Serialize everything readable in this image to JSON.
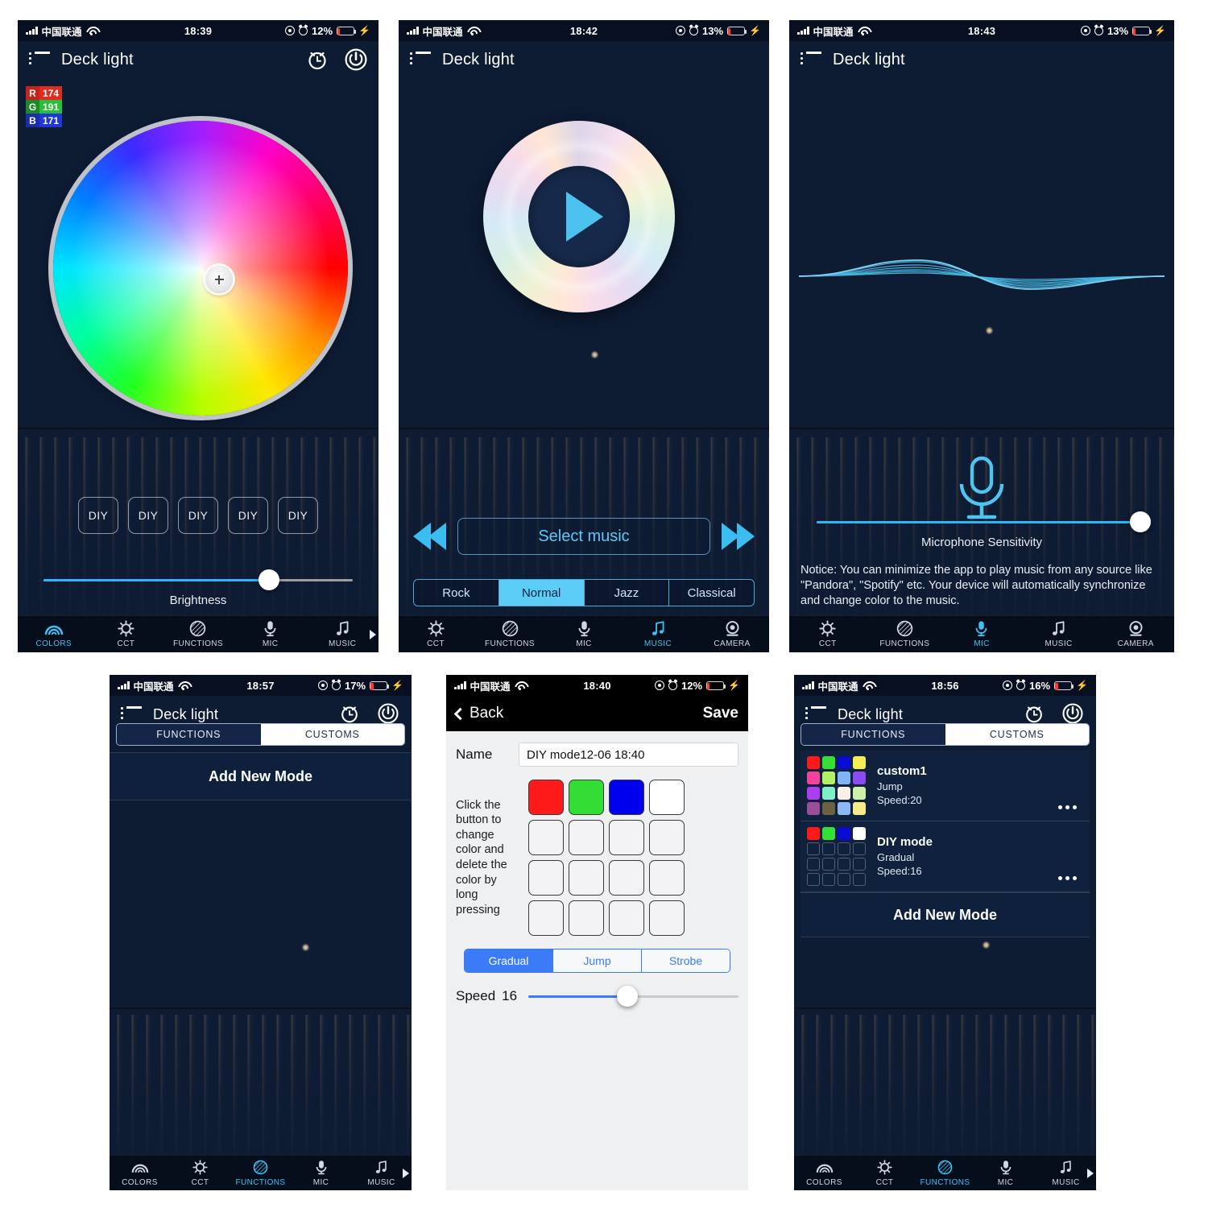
{
  "app": {
    "title": "Deck light"
  },
  "panels": {
    "colors": {
      "status": {
        "carrier": "中国联通",
        "time": "18:39",
        "battery_pct": "12%"
      },
      "rgb": {
        "r_key": "R",
        "r_val": "174",
        "g_key": "G",
        "g_val": "191",
        "b_key": "B",
        "b_val": "171"
      },
      "diy_buttons": [
        "DIY",
        "DIY",
        "DIY",
        "DIY",
        "DIY"
      ],
      "brightness_label": "Brightness",
      "brightness_pct": 73,
      "tabs": [
        {
          "label": "COLORS",
          "icon": "rainbow-icon",
          "active": true
        },
        {
          "label": "CCT",
          "icon": "sun-icon",
          "active": false
        },
        {
          "label": "FUNCTIONS",
          "icon": "hatched-circle-icon",
          "active": false
        },
        {
          "label": "MIC",
          "icon": "microphone-icon",
          "active": false
        },
        {
          "label": "MUSIC",
          "icon": "music-note-icon",
          "active": false
        }
      ]
    },
    "music": {
      "status": {
        "carrier": "中国联通",
        "time": "18:42",
        "battery_pct": "13%"
      },
      "select_music_label": "Select music",
      "prev_label": "previous",
      "next_label": "next",
      "genres": [
        {
          "label": "Rock",
          "active": false
        },
        {
          "label": "Normal",
          "active": true
        },
        {
          "label": "Jazz",
          "active": false
        },
        {
          "label": "Classical",
          "active": false
        }
      ],
      "tabs": [
        {
          "label": "CCT",
          "icon": "sun-icon",
          "active": false
        },
        {
          "label": "FUNCTIONS",
          "icon": "hatched-circle-icon",
          "active": false
        },
        {
          "label": "MIC",
          "icon": "microphone-icon",
          "active": false
        },
        {
          "label": "MUSIC",
          "icon": "music-note-icon",
          "active": true
        },
        {
          "label": "CAMERA",
          "icon": "camera-icon",
          "active": false
        }
      ]
    },
    "mic": {
      "status": {
        "carrier": "中国联通",
        "time": "18:43",
        "battery_pct": "13%"
      },
      "sensitivity_label": "Microphone Sensitivity",
      "sensitivity_pct": 97,
      "notice": "Notice: You can minimize the app to play music from any source like \"Pandora\", \"Spotify\" etc. Your device will automatically synchronize and change color to the music.",
      "tabs": [
        {
          "label": "CCT",
          "icon": "sun-icon",
          "active": false
        },
        {
          "label": "FUNCTIONS",
          "icon": "hatched-circle-icon",
          "active": false
        },
        {
          "label": "MIC",
          "icon": "microphone-icon",
          "active": true
        },
        {
          "label": "MUSIC",
          "icon": "music-note-icon",
          "active": false
        },
        {
          "label": "CAMERA",
          "icon": "camera-icon",
          "active": false
        }
      ]
    },
    "customs_empty": {
      "status": {
        "carrier": "中国联通",
        "time": "18:57",
        "battery_pct": "17%"
      },
      "seg": {
        "functions": "FUNCTIONS",
        "customs": "CUSTOMS",
        "selected": "CUSTOMS"
      },
      "add_new_mode": "Add New Mode",
      "tabs": [
        {
          "label": "COLORS",
          "icon": "rainbow-icon",
          "active": false
        },
        {
          "label": "CCT",
          "icon": "sun-icon",
          "active": false
        },
        {
          "label": "FUNCTIONS",
          "icon": "hatched-circle-icon",
          "active": true
        },
        {
          "label": "MIC",
          "icon": "microphone-icon",
          "active": false
        },
        {
          "label": "MUSIC",
          "icon": "music-note-icon",
          "active": false
        }
      ]
    },
    "diy_editor": {
      "status": {
        "carrier": "中国联通",
        "time": "18:40",
        "battery_pct": "12%"
      },
      "back_label": "Back",
      "save_label": "Save",
      "name_label": "Name",
      "name_value": "DIY mode12-06 18:40",
      "hint": "Click the button to change color and delete the color by long pressing",
      "cells": [
        "#ff1a1a",
        "#33dd33",
        "#0000ee",
        "#ffffff",
        "",
        "",
        "",
        "",
        "",
        "",
        "",
        "",
        "",
        "",
        "",
        ""
      ],
      "modes": [
        {
          "label": "Gradual",
          "active": true
        },
        {
          "label": "Jump",
          "active": false
        },
        {
          "label": "Strobe",
          "active": false
        }
      ],
      "speed_label": "Speed",
      "speed_value": "16",
      "speed_pct": 47
    },
    "customs_list": {
      "status": {
        "carrier": "中国联通",
        "time": "18:56",
        "battery_pct": "16%"
      },
      "seg": {
        "functions": "FUNCTIONS",
        "customs": "CUSTOMS",
        "selected": "CUSTOMS"
      },
      "add_new_mode": "Add New Mode",
      "items": [
        {
          "name": "custom1",
          "mode": "Jump",
          "speed": "Speed:20",
          "swatches": [
            "#ff1a1a",
            "#33e033",
            "#0a0ad8",
            "#f4ee52",
            "#f martin",
            "#b4f066",
            "#7fb4f5",
            "#8a4bf0",
            "#ad3df0",
            "#7df0c4",
            "#fdeee6",
            "#cdf0a8",
            "#9a4f96",
            "#6b6340",
            "#8cb8f5",
            "#f5ee88"
          ]
        },
        {
          "name": "DIY mode",
          "mode": "Gradual",
          "speed": "Speed:16",
          "swatches": [
            "#ff1a1a",
            "#33e033",
            "#0a0ad8",
            "#ffffff",
            "",
            "",
            "",
            "",
            "",
            "",
            "",
            "",
            "",
            "",
            "",
            ""
          ]
        }
      ],
      "tabs": [
        {
          "label": "COLORS",
          "icon": "rainbow-icon",
          "active": false
        },
        {
          "label": "CCT",
          "icon": "sun-icon",
          "active": false
        },
        {
          "label": "FUNCTIONS",
          "icon": "hatched-circle-icon",
          "active": true
        },
        {
          "label": "MIC",
          "icon": "microphone-icon",
          "active": false
        },
        {
          "label": "MUSIC",
          "icon": "music-note-icon",
          "active": false
        }
      ]
    }
  },
  "colors": {
    "accent": "#3ec2f3",
    "slider_fill": "#2fb6f2",
    "ios_blue": "#3b7cf6",
    "battery_red": "#ff3b30"
  }
}
